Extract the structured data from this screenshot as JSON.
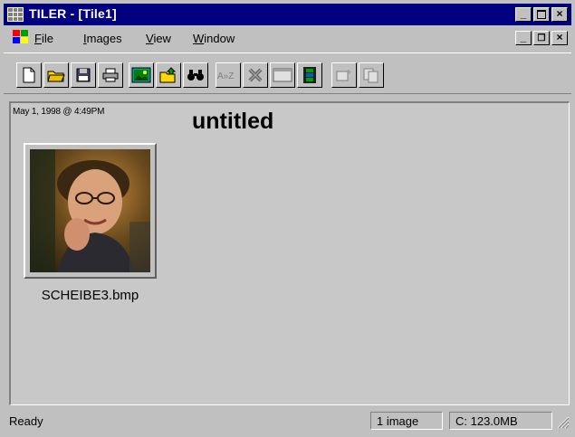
{
  "window": {
    "title": "TILER - [Tile1]"
  },
  "menubar": {
    "items": [
      {
        "underline": "F",
        "rest": "ile"
      },
      {
        "underline": "I",
        "rest": "mages"
      },
      {
        "underline": "V",
        "rest": "iew"
      },
      {
        "underline": "W",
        "rest": "indow"
      }
    ]
  },
  "toolbar": {
    "buttons": [
      "new-document-icon",
      "open-folder-icon",
      "save-disk-icon",
      "print-icon",
      "image-icon",
      "export-folder-icon",
      "find-binoculars-icon",
      "sort-a-z-icon",
      "delete-x-icon",
      "window-icon",
      "film-strip-icon",
      "send-icon",
      "copy-pages-icon"
    ]
  },
  "document": {
    "datestamp": "May 1, 1998 @ 4:49PM",
    "title": "untitled",
    "thumbnail_caption": "SCHEIBE3.bmp"
  },
  "status": {
    "text": "Ready",
    "image_count": "1 image",
    "disk": "C: 123.0MB"
  },
  "colors": {
    "titlebar": "#000080",
    "face": "#c0c0c0"
  }
}
